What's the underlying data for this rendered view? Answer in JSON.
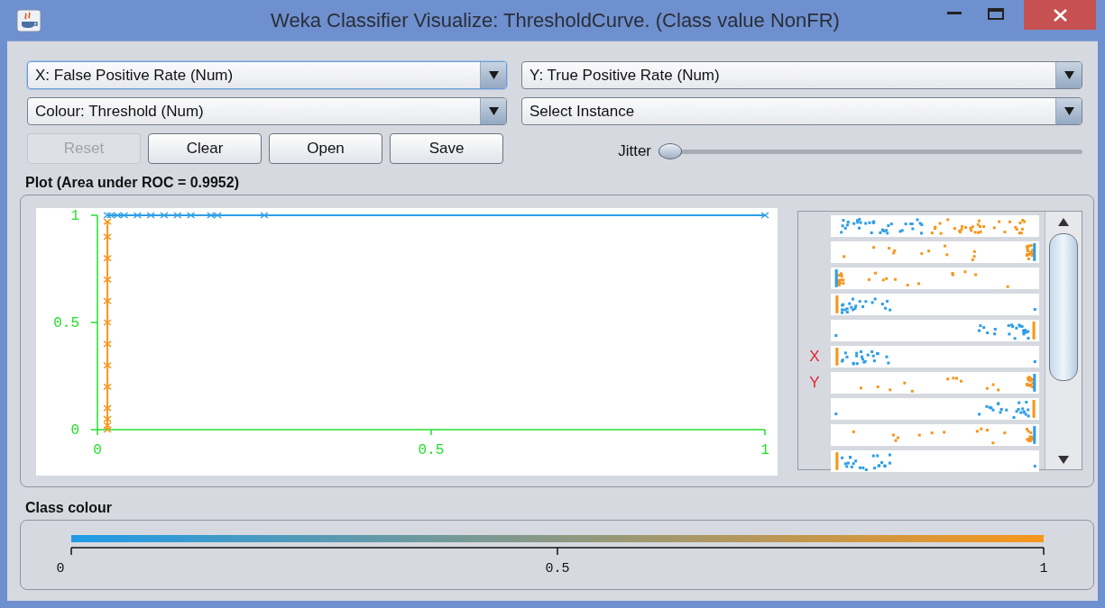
{
  "window": {
    "title": "Weka Classifier Visualize: ThresholdCurve. (Class value NonFR)"
  },
  "selectors": [
    {
      "label": "X: False Positive Rate (Num)",
      "focused": true
    },
    {
      "label": "Y: True Positive Rate (Num)",
      "focused": false
    },
    {
      "label": "Colour: Threshold (Num)",
      "focused": false
    },
    {
      "label": "Select Instance",
      "focused": false
    }
  ],
  "buttons": [
    {
      "label": "Reset",
      "disabled": true
    },
    {
      "label": "Clear",
      "disabled": false
    },
    {
      "label": "Open",
      "disabled": false
    },
    {
      "label": "Save",
      "disabled": false
    }
  ],
  "jitter": {
    "label": "Jitter",
    "level": 0
  },
  "plot": {
    "title": "Plot (Area under ROC = 0.9952)",
    "chart_data": {
      "type": "line",
      "x": [
        0.015,
        0.015,
        0.015,
        0.015,
        0.015,
        0.015,
        0.015,
        0.015,
        0.015,
        0.015,
        0.015,
        0.015,
        0.015,
        0.02,
        0.03,
        0.04,
        0.06,
        0.08,
        0.1,
        0.12,
        0.14,
        0.17,
        0.18,
        0.25,
        1
      ],
      "series": [
        {
          "color": "#f7961c",
          "marker": "x",
          "values": [
            0,
            0.02,
            0.05,
            0.1,
            0.2,
            0.3,
            0.4,
            0.5,
            0.6,
            0.7,
            0.8,
            0.9,
            0.97,
            null,
            null,
            null,
            null,
            null,
            null,
            null,
            null,
            null,
            null,
            null,
            null
          ]
        },
        {
          "color": "#2d9ee6",
          "marker": "x",
          "values": [
            null,
            null,
            null,
            null,
            null,
            null,
            null,
            null,
            null,
            null,
            null,
            null,
            1,
            1,
            1,
            1,
            1,
            1,
            1,
            1,
            1,
            1,
            1,
            1,
            1
          ]
        }
      ],
      "xlim": [
        0,
        1
      ],
      "ylim": [
        0,
        1
      ],
      "xticks": [
        0,
        0.5,
        1
      ],
      "yticks": [
        0,
        0.5,
        1
      ]
    }
  },
  "attribute_strips": [
    {
      "kind": "mixed"
    },
    {
      "kind": "peak-right"
    },
    {
      "kind": "peak-left"
    },
    {
      "kind": "cluster-left"
    },
    {
      "kind": "cluster-right"
    },
    {
      "kind": "cluster-left",
      "axis_label": "X"
    },
    {
      "kind": "peak-right",
      "axis_label": "Y"
    },
    {
      "kind": "cluster-right"
    },
    {
      "kind": "peak-right"
    },
    {
      "kind": "cluster-left"
    }
  ],
  "class_colour": {
    "title": "Class colour",
    "ticks": [
      "0",
      "0.5",
      "1"
    ]
  }
}
